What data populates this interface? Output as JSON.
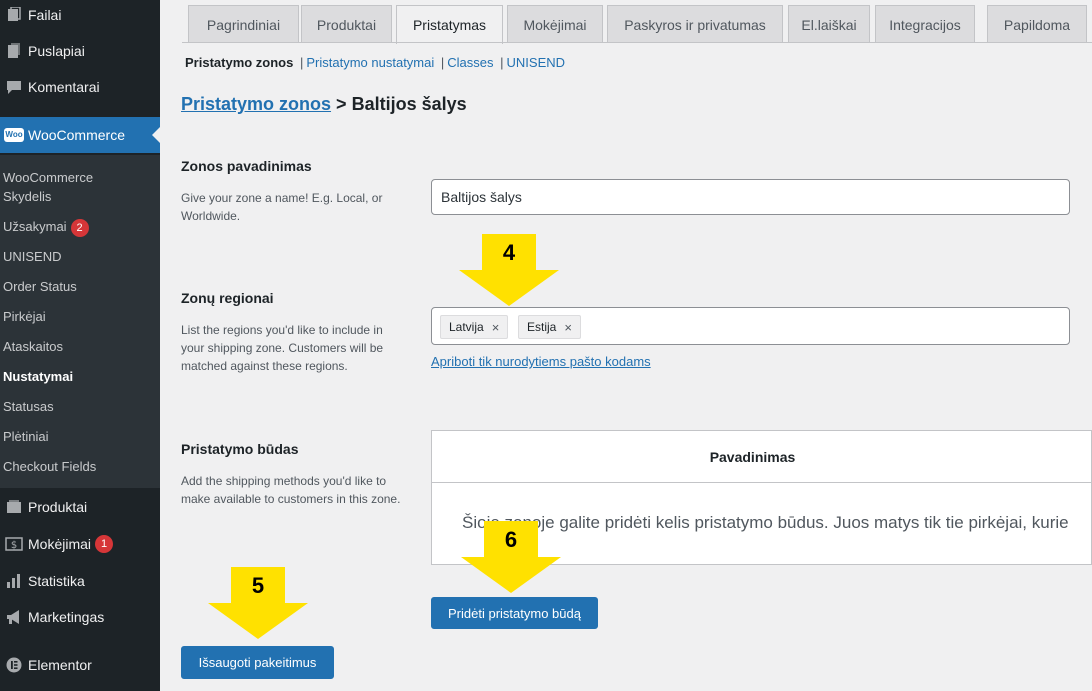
{
  "sidebar": {
    "top_items": [
      {
        "label": "Failai",
        "icon": "media-icon"
      },
      {
        "label": "Puslapiai",
        "icon": "page-icon"
      },
      {
        "label": "Komentarai",
        "icon": "comment-icon"
      }
    ],
    "woocommerce": {
      "label": "WooCommerce",
      "icon": "woo-icon",
      "logo_text": "Woo"
    },
    "submenu": [
      {
        "label": "WooCommerce Skydelis"
      },
      {
        "label": "Užsakymai",
        "badge": "2"
      },
      {
        "label": "UNISEND"
      },
      {
        "label": "Order Status"
      },
      {
        "label": "Pirkėjai"
      },
      {
        "label": "Ataskaitos"
      },
      {
        "label": "Nustatymai",
        "current": true
      },
      {
        "label": "Statusas"
      },
      {
        "label": "Plėtiniai"
      },
      {
        "label": "Checkout Fields"
      }
    ],
    "bottom_items": [
      {
        "label": "Produktai",
        "icon": "product-icon"
      },
      {
        "label": "Mokėjimai",
        "icon": "payment-icon",
        "badge": "1"
      },
      {
        "label": "Statistika",
        "icon": "chart-icon"
      },
      {
        "label": "Marketingas",
        "icon": "megaphone-icon"
      },
      {
        "label": "Elementor",
        "icon": "elementor-icon"
      }
    ]
  },
  "tabs": [
    {
      "label": "Pagrindiniai"
    },
    {
      "label": "Produktai"
    },
    {
      "label": "Pristatymas",
      "active": true
    },
    {
      "label": "Mokėjimai"
    },
    {
      "label": "Paskyros ir privatumas"
    },
    {
      "label": "El.laiškai"
    },
    {
      "label": "Integracijos"
    },
    {
      "label": "Papildoma"
    }
  ],
  "subnav": {
    "current": "Pristatymo zonos",
    "links": [
      "Pristatymo nustatymai",
      "Classes",
      "UNISEND"
    ]
  },
  "breadcrumb": {
    "link": "Pristatymo zonos",
    "separator": ">",
    "current": "Baltijos šalys"
  },
  "zone_name": {
    "title": "Zonos pavadinimas",
    "description": "Give your zone a name! E.g. Local, or Worldwide.",
    "value": "Baltijos šalys"
  },
  "regions": {
    "title": "Zonų regionai",
    "description": "List the regions you'd like to include in your shipping zone. Customers will be matched against these regions.",
    "chips": [
      "Latvija",
      "Estija"
    ],
    "remove_glyph": "×",
    "postcode_link": "Apriboti tik nurodytiems pašto kodams"
  },
  "methods": {
    "title": "Pristatymo būdas",
    "description": "Add the shipping methods you'd like to make available to customers in this zone.",
    "column_header": "Pavadinimas",
    "empty_text": "Šioje zonoje galite pridėti kelis pristatymo būdus. Juos matys tik tie pirkėjai, kurie",
    "add_button": "Pridėti pristatymo būdą"
  },
  "save_button": "Išsaugoti pakeitimus",
  "annotations": {
    "arrow_4": "4",
    "arrow_5": "5",
    "arrow_6": "6",
    "color": "#ffe100"
  },
  "colors": {
    "accent": "#2271b1",
    "sidebar_bg": "#1d2327",
    "badge": "#d63638"
  }
}
